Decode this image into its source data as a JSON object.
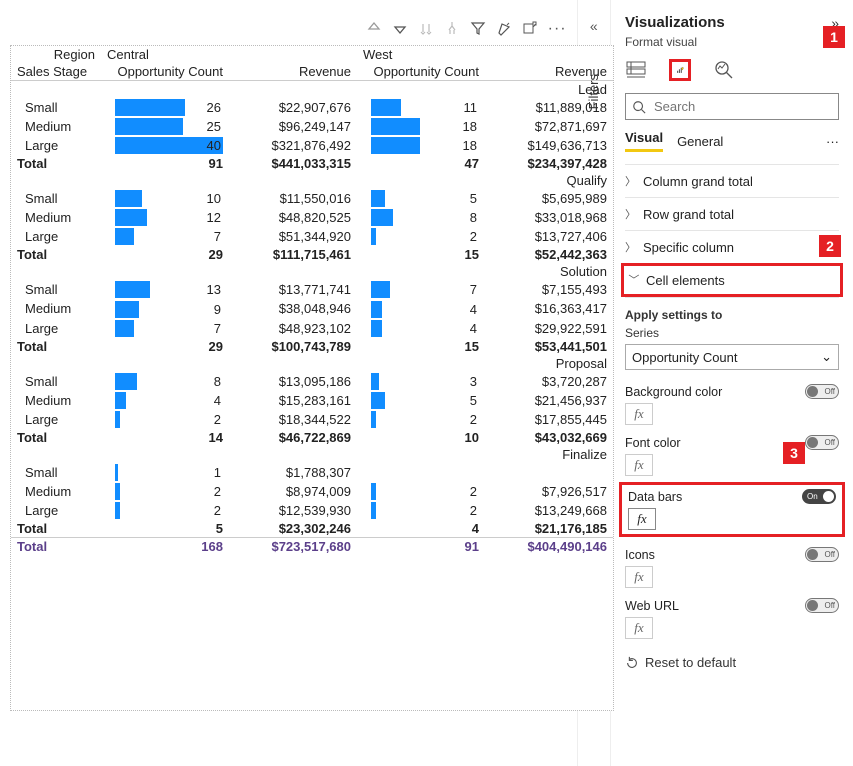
{
  "toolbar": {
    "icons": [
      "arrow-up",
      "arrow-down",
      "sort-desc",
      "hierarchy",
      "filter",
      "highlight",
      "popout",
      "more"
    ]
  },
  "matrix": {
    "row_header_label": "Region",
    "row_subheader_label": "Sales Stage",
    "column_groups": [
      "Central",
      "West"
    ],
    "measures": [
      "Opportunity Count",
      "Revenue"
    ],
    "max_oc": 40,
    "stages": [
      {
        "name": "Lead",
        "rows": [
          {
            "size": "Small",
            "c_oc": 26,
            "c_rev": "$22,907,676",
            "w_oc": 11,
            "w_rev": "$11,889,018"
          },
          {
            "size": "Medium",
            "c_oc": 25,
            "c_rev": "$96,249,147",
            "w_oc": 18,
            "w_rev": "$72,871,697"
          },
          {
            "size": "Large",
            "c_oc": 40,
            "c_rev": "$321,876,492",
            "w_oc": 18,
            "w_rev": "$149,636,713"
          }
        ],
        "total": {
          "c_oc": 91,
          "c_rev": "$441,033,315",
          "w_oc": 47,
          "w_rev": "$234,397,428"
        }
      },
      {
        "name": "Qualify",
        "rows": [
          {
            "size": "Small",
            "c_oc": 10,
            "c_rev": "$11,550,016",
            "w_oc": 5,
            "w_rev": "$5,695,989"
          },
          {
            "size": "Medium",
            "c_oc": 12,
            "c_rev": "$48,820,525",
            "w_oc": 8,
            "w_rev": "$33,018,968"
          },
          {
            "size": "Large",
            "c_oc": 7,
            "c_rev": "$51,344,920",
            "w_oc": 2,
            "w_rev": "$13,727,406"
          }
        ],
        "total": {
          "c_oc": 29,
          "c_rev": "$111,715,461",
          "w_oc": 15,
          "w_rev": "$52,442,363"
        }
      },
      {
        "name": "Solution",
        "rows": [
          {
            "size": "Small",
            "c_oc": 13,
            "c_rev": "$13,771,741",
            "w_oc": 7,
            "w_rev": "$7,155,493"
          },
          {
            "size": "Medium",
            "c_oc": 9,
            "c_rev": "$38,048,946",
            "w_oc": 4,
            "w_rev": "$16,363,417"
          },
          {
            "size": "Large",
            "c_oc": 7,
            "c_rev": "$48,923,102",
            "w_oc": 4,
            "w_rev": "$29,922,591"
          }
        ],
        "total": {
          "c_oc": 29,
          "c_rev": "$100,743,789",
          "w_oc": 15,
          "w_rev": "$53,441,501"
        }
      },
      {
        "name": "Proposal",
        "rows": [
          {
            "size": "Small",
            "c_oc": 8,
            "c_rev": "$13,095,186",
            "w_oc": 3,
            "w_rev": "$3,720,287"
          },
          {
            "size": "Medium",
            "c_oc": 4,
            "c_rev": "$15,283,161",
            "w_oc": 5,
            "w_rev": "$21,456,937"
          },
          {
            "size": "Large",
            "c_oc": 2,
            "c_rev": "$18,344,522",
            "w_oc": 2,
            "w_rev": "$17,855,445"
          }
        ],
        "total": {
          "c_oc": 14,
          "c_rev": "$46,722,869",
          "w_oc": 10,
          "w_rev": "$43,032,669"
        }
      },
      {
        "name": "Finalize",
        "rows": [
          {
            "size": "Small",
            "c_oc": 1,
            "c_rev": "$1,788,307",
            "w_oc": null,
            "w_rev": ""
          },
          {
            "size": "Medium",
            "c_oc": 2,
            "c_rev": "$8,974,009",
            "w_oc": 2,
            "w_rev": "$7,926,517"
          },
          {
            "size": "Large",
            "c_oc": 2,
            "c_rev": "$12,539,930",
            "w_oc": 2,
            "w_rev": "$13,249,668"
          }
        ],
        "total": {
          "c_oc": 5,
          "c_rev": "$23,302,246",
          "w_oc": 4,
          "w_rev": "$21,176,185"
        }
      }
    ],
    "grand_total": {
      "label": "Total",
      "c_oc": 168,
      "c_rev": "$723,517,680",
      "w_oc": 91,
      "w_rev": "$404,490,146"
    }
  },
  "filters_label": "Filters",
  "pane": {
    "title": "Visualizations",
    "subtitle": "Format visual",
    "search_placeholder": "Search",
    "subtabs": {
      "visual": "Visual",
      "general": "General"
    },
    "accordion": {
      "col_total": "Column grand total",
      "row_total": "Row grand total",
      "specific": "Specific column",
      "cell_elements": "Cell elements"
    },
    "apply_label": "Apply settings to",
    "series_label": "Series",
    "series_value": "Opportunity Count",
    "toggles": {
      "bg": "Background color",
      "font": "Font color",
      "bars": "Data bars",
      "icons": "Icons",
      "url": "Web URL"
    },
    "fx": "fx",
    "on": "On",
    "off": "Off",
    "reset": "Reset to default"
  },
  "callouts": {
    "one": "1",
    "two": "2",
    "three": "3"
  }
}
